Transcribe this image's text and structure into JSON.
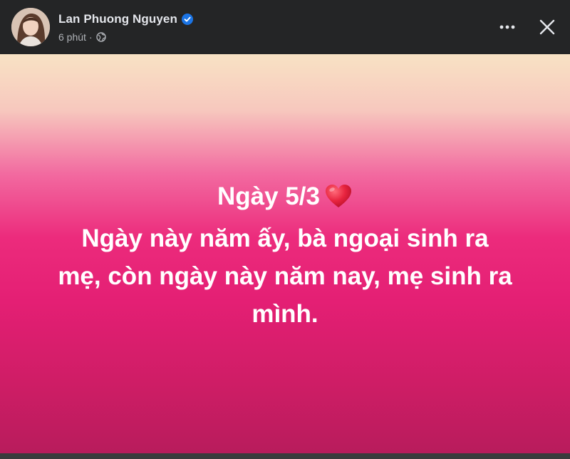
{
  "post": {
    "author_name": "Lan Phuong Nguyen",
    "timestamp": "6 phút",
    "separator": "·",
    "privacy_icon": "globe-icon",
    "verified_icon": "verified-badge-icon",
    "actions": {
      "more_icon": "more-options-icon",
      "close_icon": "close-icon"
    },
    "body": {
      "line1": "Ngày 5/3",
      "line1_emoji": "heart-icon",
      "line2": "Ngày này năm ấy, bà ngoại sinh ra",
      "line3": "mẹ, còn ngày này năm nay, mẹ sinh ra",
      "line4": "mình."
    }
  },
  "colors": {
    "header_bg": "#242526",
    "name_text": "#e4e6eb",
    "meta_text": "#b0b3b8",
    "verified_blue": "#1b74e4",
    "gradient_top": "#f8e2c4",
    "gradient_mid": "#ec2b7c",
    "gradient_bottom": "#b81c5c",
    "heart_red": "#e0245e"
  }
}
